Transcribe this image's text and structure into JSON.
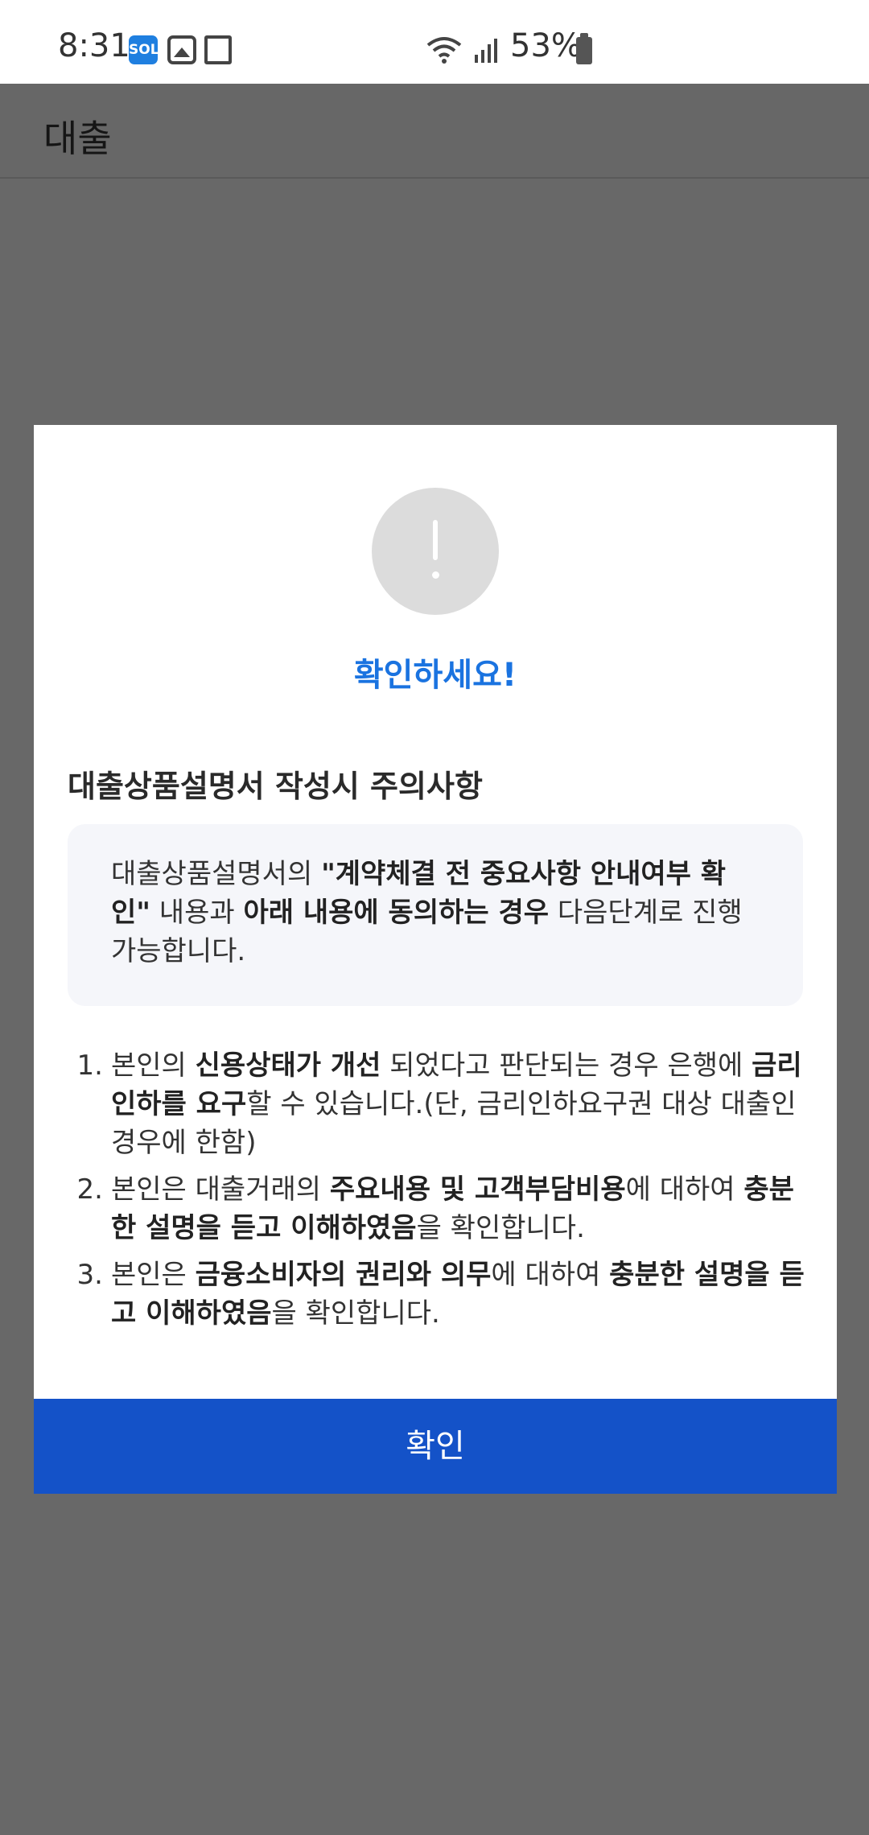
{
  "status_bar": {
    "time": "8:31",
    "battery": "53%",
    "app_icon_sol": "SOL"
  },
  "header": {
    "title": "대출"
  },
  "dialog": {
    "title": "확인하세요!",
    "heading": "대출상품설명서 작성시 주의사항",
    "notice": {
      "part1": "대출상품설명서의 ",
      "bold1": "\"계약체결 전 중요사항 안내여부 확인\"",
      "part2": " 내용과 ",
      "bold2": "아래 내용에 동의하는 경우",
      "part3": " 다음단계로 진행 가능합니다."
    },
    "terms": [
      {
        "num": "1.",
        "t1": "본인의 ",
        "b1": "신용상태가 개선",
        "t2": " 되었다고 판단되는 경우 은행에 ",
        "b2": "금리인하를 요구",
        "t3": "할 수 있습니다.(단, 금리인하요구권 대상 대출인 경우에 한함)"
      },
      {
        "num": "2.",
        "t1": "본인은 대출거래의 ",
        "b1": "주요내용 및 고객부담비용",
        "t2": "에 대하여 ",
        "b2": "충분한 설명을 듣고 이해하였음",
        "t3": "을 확인합니다."
      },
      {
        "num": "3.",
        "t1": "본인은 ",
        "b1": "금융소비자의 권리와 의무",
        "t2": "에 대하여 ",
        "b2": "충분한 설명을 듣고 이해하였음",
        "t3": "을 확인합니다."
      }
    ],
    "confirm_label": "확인"
  },
  "colors": {
    "accent": "#1a73e0",
    "button": "#1452c8",
    "overlay": "#686868"
  }
}
